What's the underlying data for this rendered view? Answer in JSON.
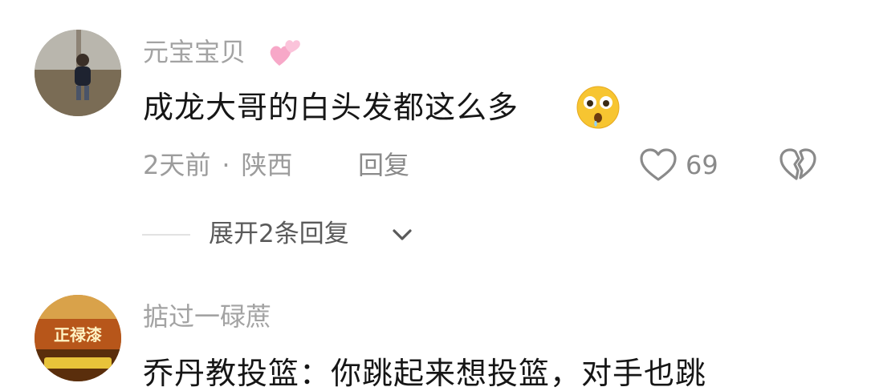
{
  "comments": [
    {
      "username": "元宝宝贝",
      "username_emoji": "pink-hearts-emoji",
      "content": "成龙大哥的白头发都这么多",
      "content_emoji": "astonished-face-emoji",
      "time": "2天前",
      "separator": "·",
      "location": "陕西",
      "reply_label": "回复",
      "like_count": "69",
      "expand_replies": "展开2条回复"
    },
    {
      "username": "掂过一碌蔗",
      "content": "乔丹教投篮：你跳起来想投篮，对手也跳",
      "avatar_text": "正禄漆"
    }
  ],
  "icons": {
    "like": "heart-outline-icon",
    "dislike": "broken-heart-icon",
    "expand": "chevron-down-icon"
  },
  "colors": {
    "username": "#a3a3a3",
    "content": "#161616",
    "meta": "#9c9c9c",
    "emoji_pink": "#f7a8c8",
    "emoji_yellow": "#f7c531"
  }
}
